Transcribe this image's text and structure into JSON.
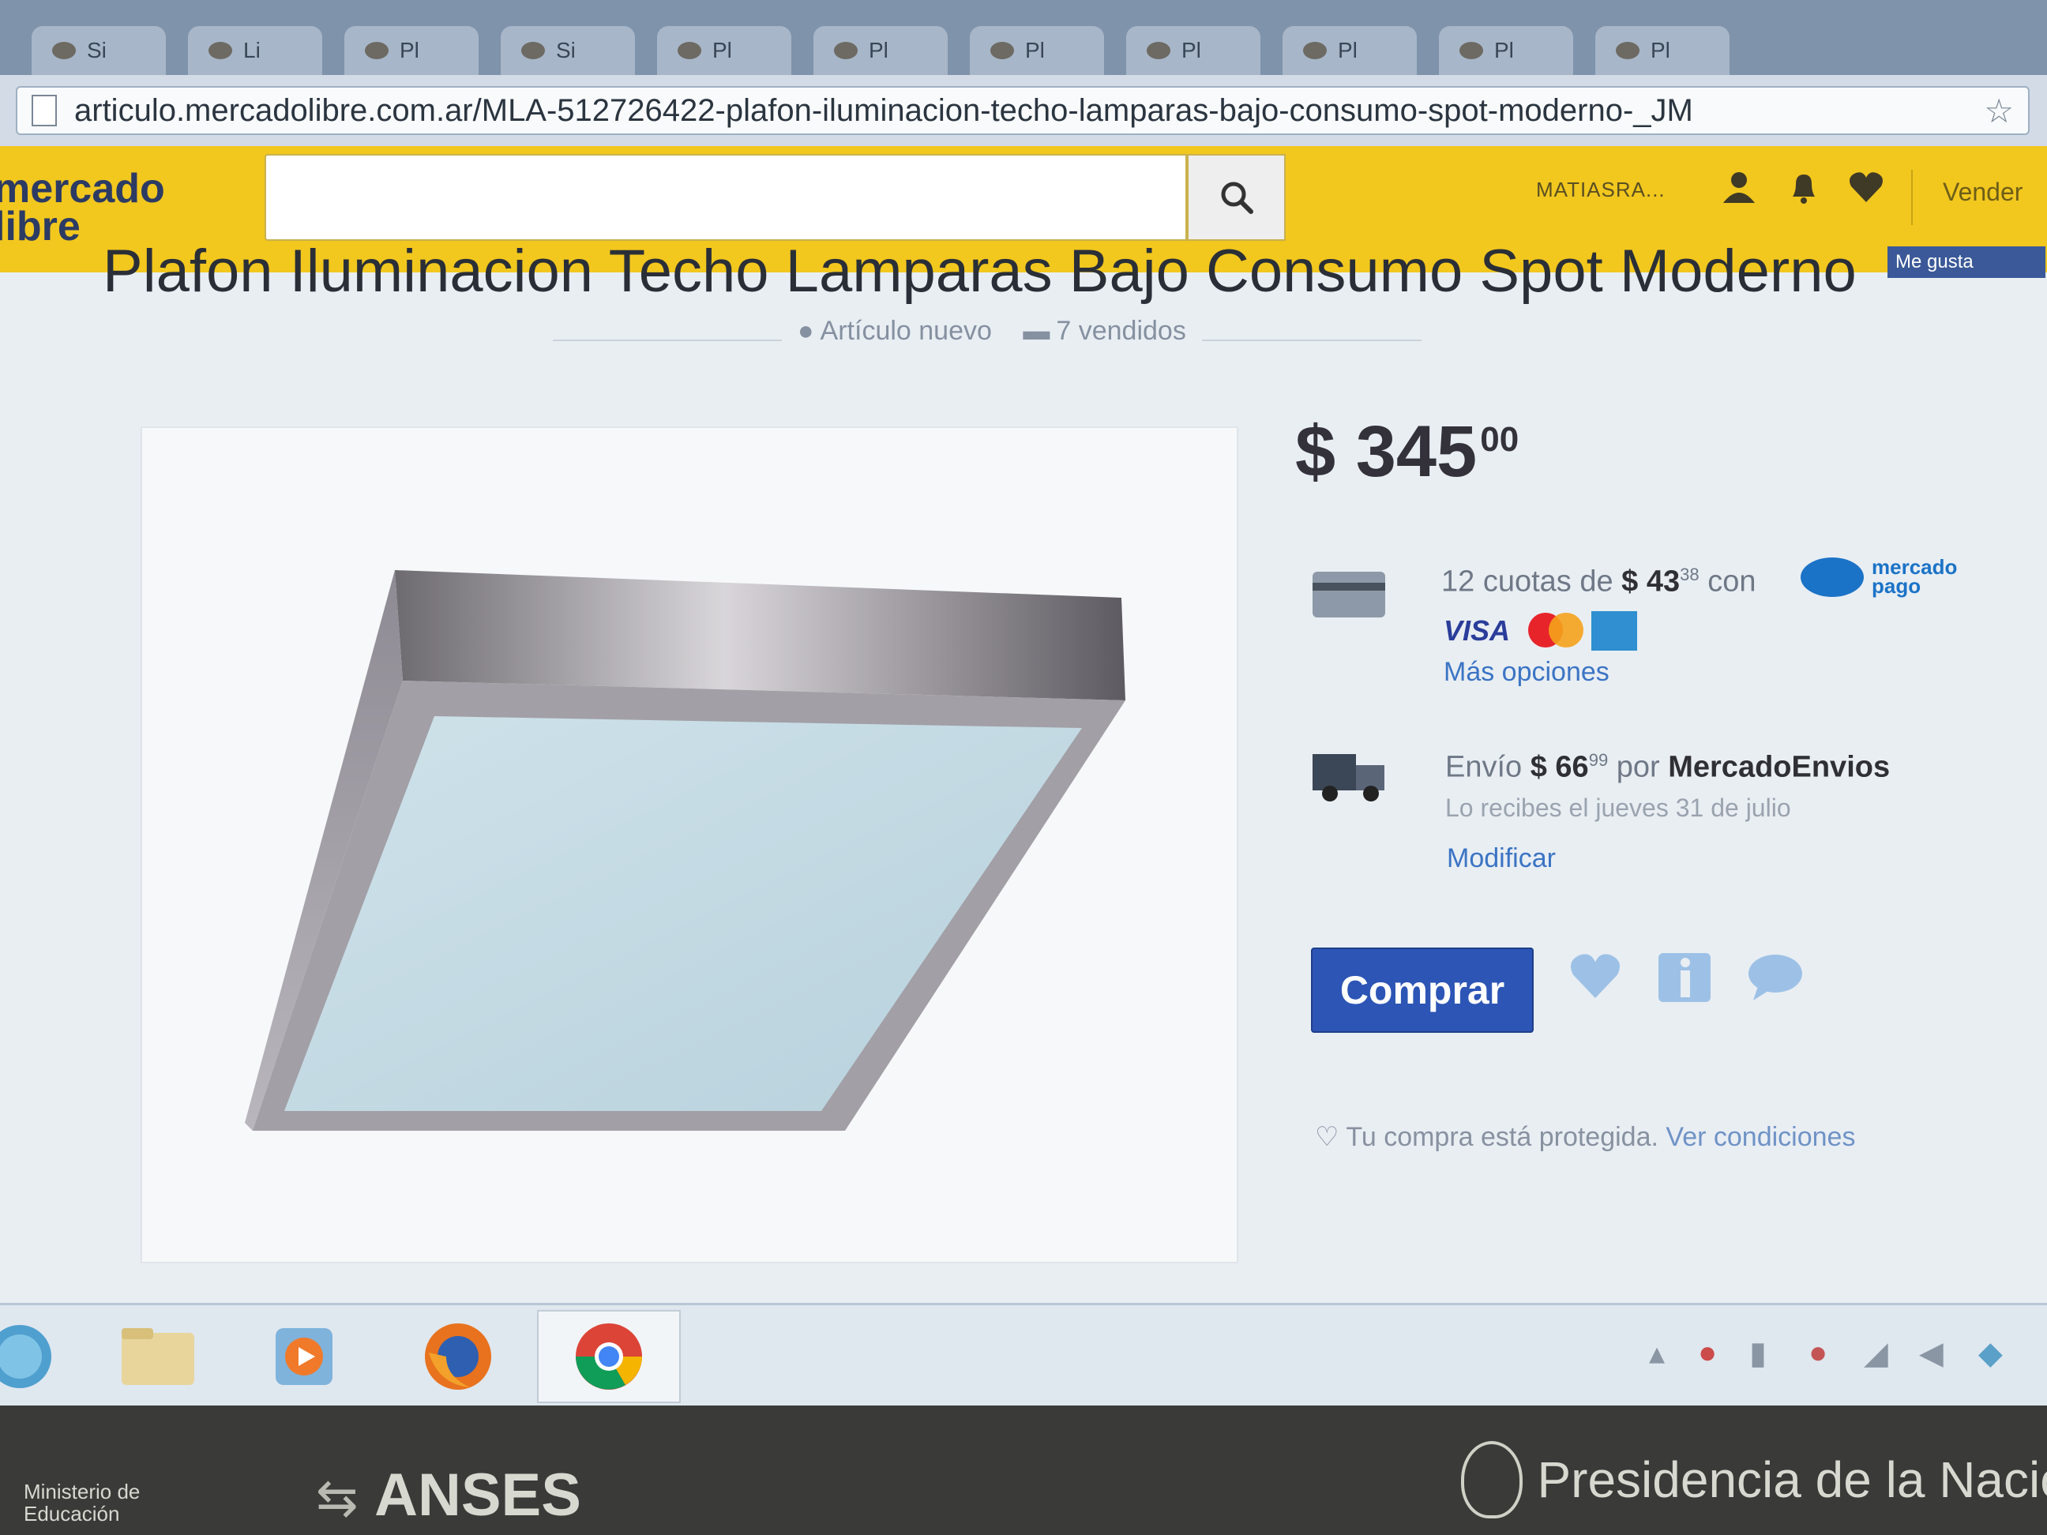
{
  "browser": {
    "tabs": [
      "Si",
      "Li",
      "Pl",
      "Si",
      "Pl",
      "Pl",
      "Pl",
      "Pl",
      "Pl",
      "Pl",
      "Pl"
    ],
    "url": "articulo.mercadolibre.com.ar/MLA-512726422-plafon-iluminacion-techo-lamparas-bajo-consumo-spot-moderno-_JM",
    "star_glyph": "☆"
  },
  "header": {
    "logo_line1": "mercado",
    "logo_line2": "libre",
    "search_value": "",
    "search_icon": "search-icon",
    "username": "MATIASRA...",
    "vender": "Vender"
  },
  "product": {
    "title": "Plafon Iluminacion Techo Lamparas Bajo Consumo Spot Moderno",
    "fb_like": "Me gusta",
    "condition": "Artículo nuevo",
    "sold": "7 vendidos",
    "price_int": "$ 345",
    "price_dec": "00",
    "installments_prefix": "12 cuotas de",
    "installments_amount": "$ 43",
    "installments_dec": "38",
    "installments_with": "con",
    "mp_line1": "mercado",
    "mp_line2": "pago",
    "visa": "VISA",
    "more_options": "Más opciones",
    "shipping_prefix": "Envío",
    "shipping_amount": "$ 66",
    "shipping_dec": "99",
    "shipping_by": "por",
    "shipping_service": "MercadoEnvios",
    "delivery": "Lo recibes el jueves 31 de julio",
    "modify": "Modificar",
    "buy": "Comprar",
    "protected": "Tu compra está protegida.",
    "conditions": "Ver condiciones"
  },
  "taskbar": {
    "apps": [
      "start-orb-icon",
      "file-explorer-icon",
      "media-player-icon",
      "firefox-icon",
      "chrome-icon"
    ]
  },
  "bezel": {
    "ministerio_line1": "Ministerio de",
    "ministerio_line2": "Educación",
    "anses": "ANSES",
    "presidencia": "Presidencia de la Nación"
  },
  "colors": {
    "ml_yellow": "#f2c71e",
    "buy_blue": "#2c55b5",
    "link_blue": "#3b74c4"
  }
}
